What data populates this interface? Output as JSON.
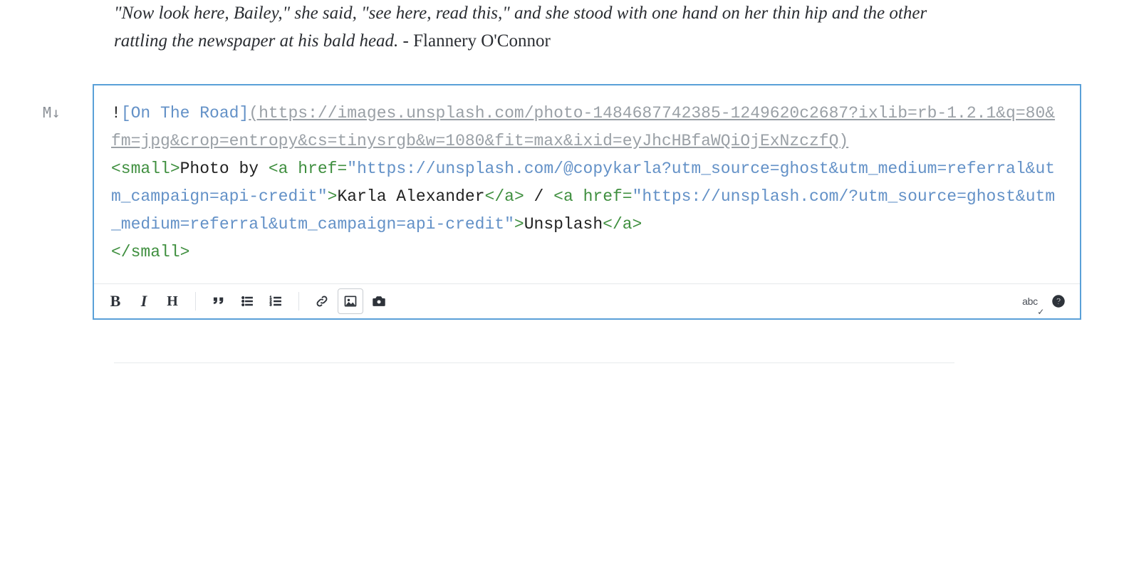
{
  "quote": {
    "line1": "\"Now look here, Bailey,\" she said, \"see here, read this,\" and she stood with one hand on her thin hip and the other rattling the newspaper at his bald head.",
    "authorPrefix": " - ",
    "author": "Flannery O'Connor"
  },
  "cellIndicator": "M↓",
  "md": {
    "bang": "!",
    "bracketOpen": "[",
    "altText": "On The Road",
    "bracketClose": "]",
    "urlOpen": "(",
    "imageUrl": "https://images.unsplash.com/photo-1484687742385-1249620c2687?ixlib=rb-1.2.1&q=80&fm=jpg&crop=entropy&cs=tinysrgb&w=1080&fit=max&ixid=eyJhcHBfaWQiOjExNzczfQ)",
    "smallOpen": "<small>",
    "photoBy": "Photo by ",
    "aOpen1": "<a",
    "hrefWord1": " href=",
    "q1a": "\"",
    "href1": "https://unsplash.com/@copykarla?utm_source=ghost&utm_medium=referral&utm_campaign=api-credit",
    "q1b": "\"",
    "gt1": ">",
    "linkText1": "Karla Alexander",
    "aClose1": "</a>",
    "slash": " / ",
    "aOpen2": "<a",
    "hrefWord2": " href=",
    "q2a": "\"",
    "href2": "https://unsplash.com/?utm_source=ghost&utm_medium=referral&utm_campaign=api-credit",
    "q2b": "\"",
    "gt2": ">",
    "linkText2": "Unsplash",
    "aClose2": "</a>",
    "smallClose": "</small>"
  },
  "toolbar": {
    "bold": "B",
    "italic": "I",
    "heading": "H",
    "spell": "abc"
  }
}
